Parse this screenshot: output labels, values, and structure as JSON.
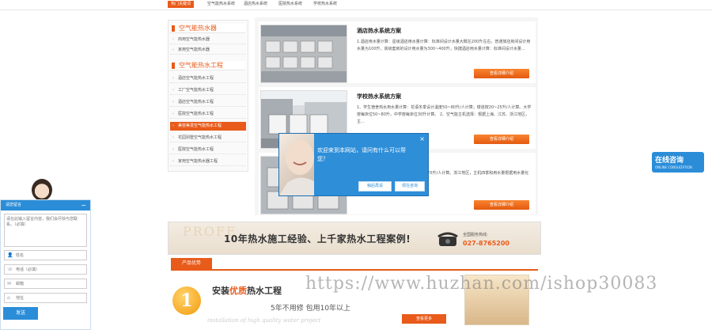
{
  "top_nav": {
    "items": [
      "热门关键词",
      "空气能热水系统",
      "酒店热水系统",
      "医院热水系统",
      "学校热水系统"
    ]
  },
  "sidebar": {
    "section1_title": "空气能热水器",
    "section1_items": [
      "商用空气能热水器",
      "家用空气能热水器"
    ],
    "section2_title": "空气能热水工程",
    "section2_items": [
      "酒店空气能热水工程",
      "工厂空气能热水工程",
      "酒店空气能热水工程",
      "医院空气能热水工程",
      "美容美发空气能热水工程",
      "花园别墅空气能热水工程",
      "医院空气能热水工程",
      "家用空气能热水器工程"
    ],
    "active_index": 4
  },
  "cases": [
    {
      "title": "酒店热水系统方案",
      "desc": "1.酒店用水量计算：星级酒店用水量计算：标准间设计水量大概在200升左右，普通旅店房间设计用水量为100升，高级套房的设计用水量为300~400升，快捷酒店用水量计算：标准间设计水量...",
      "button": "查看详细介绍"
    },
    {
      "title": "学校热水系统方案",
      "desc": "1、学生宿舍热水用水量计算：花语冬季设计温度50~80升/人计算；楼道按20~25升/人计算。大学按每床位50~80升，中学按每床位30升计算。 2、空气能主机选择：根据上海、江苏、浙江地区，主...",
      "button": "查看详细介绍"
    },
    {
      "title": "",
      "desc": "设计温度50~80升/人计算；楼道按20~25升/人计算。浙江地区，主机四季和用水量根据用水量化至少7至1.5",
      "button": "查看详细介绍"
    }
  ],
  "banner": {
    "headline": "10年热水施工经验、上千家热水工程案例!",
    "ghost_text": "PROFE",
    "hotline_label": "全国服务热线:",
    "hotline_number": "027-8765200"
  },
  "advantage": {
    "tab_label": "产品优势",
    "number": "1",
    "title_prefix": "安装",
    "title_highlight": "优质",
    "title_suffix": "热水工程",
    "subtitle": "5年不用修 包用10年以上",
    "english": "installation of high quality water project",
    "button": "查看更多"
  },
  "popup": {
    "message": "欢迎来到本网站，请问有什么可以帮您？",
    "later_button": "稍后再说",
    "consult_button": "现在咨询",
    "close": "×"
  },
  "online_consult": {
    "title": "在线咨询",
    "subtitle": "ONLINE CONSULTATION"
  },
  "message_panel": {
    "title": "请您留言",
    "close": "−",
    "textarea_placeholder": "请在此输入留言内容，我们会尽快与您联系。（必填）",
    "name_placeholder": "姓名",
    "phone_placeholder": "电话（必填）",
    "email_placeholder": "邮箱",
    "address_placeholder": "地址",
    "send_button": "发送"
  },
  "watermark": "https://www.huzhan.com/ishop30083",
  "colors": {
    "accent": "#e85b1a",
    "blue": "#2b8dd8"
  }
}
